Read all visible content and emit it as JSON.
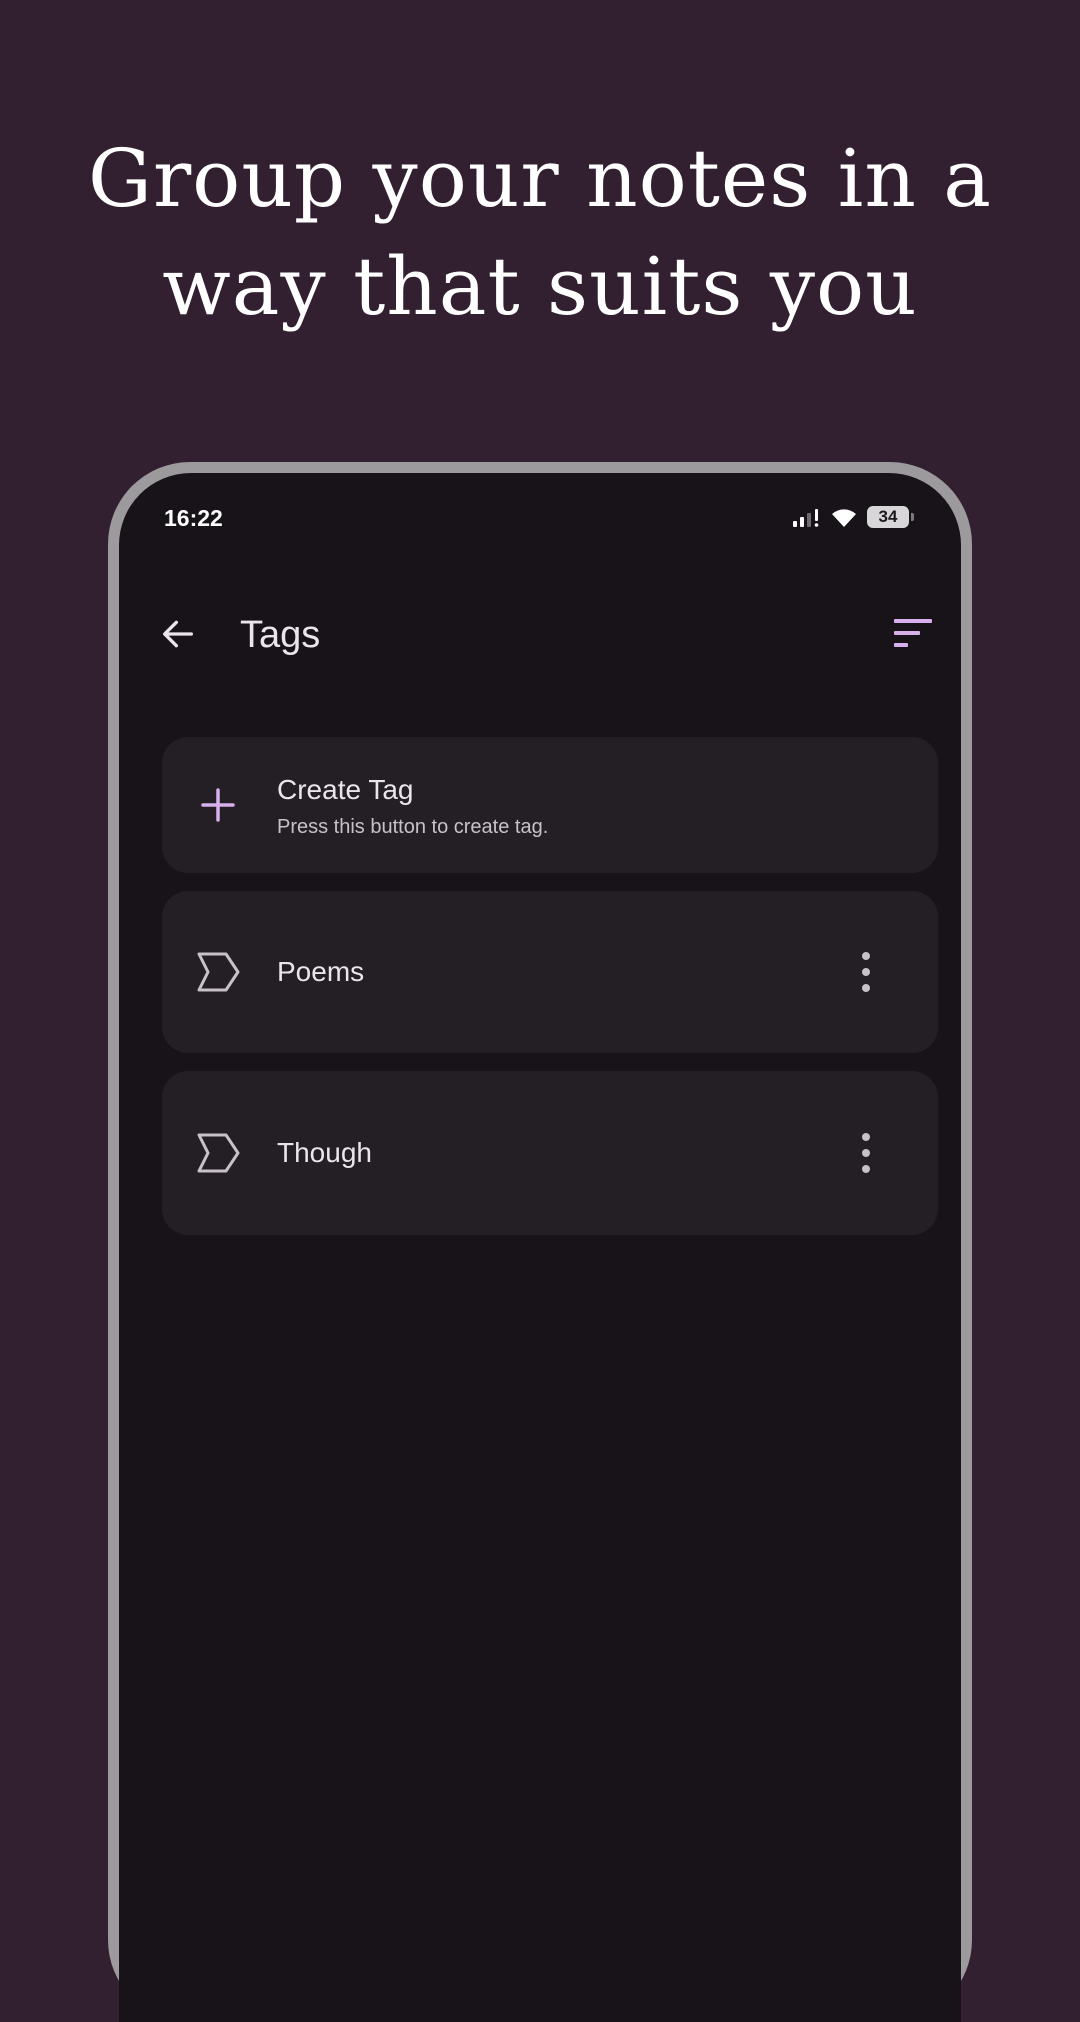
{
  "headline": "Group your notes in a way that suits you",
  "status_bar": {
    "time": "16:22",
    "battery": "34",
    "signal_icon": "signal-icon",
    "wifi_icon": "wifi-icon"
  },
  "toolbar": {
    "title": "Tags",
    "back_icon": "arrow-back-icon",
    "sort_icon": "sort-icon"
  },
  "create_tag": {
    "title": "Create Tag",
    "subtitle": "Press this button to create tag.",
    "icon": "plus-icon"
  },
  "tags": [
    {
      "label": "Poems",
      "icon": "label-tag-icon",
      "menu_icon": "more-vertical-icon"
    },
    {
      "label": "Though",
      "icon": "label-tag-icon",
      "menu_icon": "more-vertical-icon"
    }
  ],
  "colors": {
    "page_background": "#321f30",
    "screen_background": "#181319",
    "card_background": "#231f24",
    "accent": "#d7b0ed",
    "text_primary": "#ebe4ec",
    "text_secondary": "#c8c1c9"
  }
}
